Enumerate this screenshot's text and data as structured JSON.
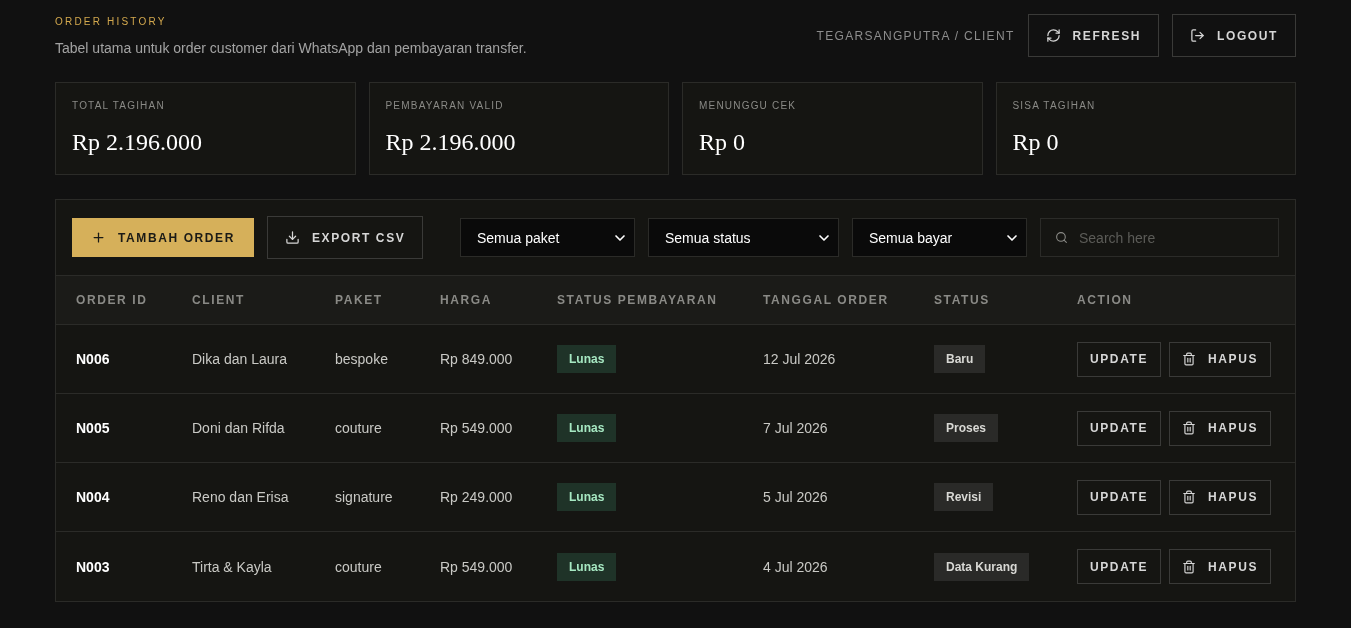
{
  "header": {
    "eyebrow": "ORDER HISTORY",
    "subtitle": "Tabel utama untuk order customer dari WhatsApp dan pembayaran transfer.",
    "user": "TEGARSANGPUTRA / CLIENT",
    "buttons": [
      {
        "kind": "refresh",
        "label": "REFRESH"
      },
      {
        "kind": "logout",
        "label": "LOGOUT"
      }
    ]
  },
  "stats": [
    {
      "label": "TOTAL TAGIHAN",
      "value": "Rp 2.196.000"
    },
    {
      "label": "PEMBAYARAN VALID",
      "value": "Rp 2.196.000"
    },
    {
      "label": "MENUNGGU CEK",
      "value": "Rp 0"
    },
    {
      "label": "SISA TAGIHAN",
      "value": "Rp 0"
    }
  ],
  "toolbar": {
    "buttons": [
      {
        "kind": "add",
        "label": "TAMBAH ORDER"
      },
      {
        "kind": "export",
        "label": "EXPORT CSV"
      }
    ],
    "filters": [
      {
        "value": "Semua paket"
      },
      {
        "value": "Semua status"
      },
      {
        "value": "Semua bayar"
      }
    ],
    "search": {
      "placeholder": "Search here"
    }
  },
  "table": {
    "columns": [
      "ORDER ID",
      "CLIENT",
      "PAKET",
      "HARGA",
      "STATUS PEMBAYARAN",
      "TANGGAL ORDER",
      "STATUS",
      "ACTION"
    ],
    "rows": [
      {
        "order_id": "N006",
        "client": "Dika dan Laura",
        "package": "bespoke",
        "price": "Rp 849.000",
        "payment": "Lunas",
        "date": "12 Jul 2026",
        "status": "Baru",
        "actions": [
          {
            "kind": "update",
            "label": "UPDATE"
          },
          {
            "kind": "delete",
            "label": "HAPUS"
          }
        ]
      },
      {
        "order_id": "N005",
        "client": "Doni dan Rifda",
        "package": "couture",
        "price": "Rp 549.000",
        "payment": "Lunas",
        "date": "7 Jul 2026",
        "status": "Proses",
        "actions": [
          {
            "kind": "update",
            "label": "UPDATE"
          },
          {
            "kind": "delete",
            "label": "HAPUS"
          }
        ]
      },
      {
        "order_id": "N004",
        "client": "Reno dan Erisa",
        "package": "signature",
        "price": "Rp 249.000",
        "payment": "Lunas",
        "date": "5 Jul 2026",
        "status": "Revisi",
        "actions": [
          {
            "kind": "update",
            "label": "UPDATE"
          },
          {
            "kind": "delete",
            "label": "HAPUS"
          }
        ]
      },
      {
        "order_id": "N003",
        "client": "Tirta & Kayla",
        "package": "couture",
        "price": "Rp 549.000",
        "payment": "Lunas",
        "date": "4 Jul 2026",
        "status": "Data Kurang",
        "actions": [
          {
            "kind": "update",
            "label": "UPDATE"
          },
          {
            "kind": "delete",
            "label": "HAPUS"
          }
        ]
      }
    ]
  }
}
